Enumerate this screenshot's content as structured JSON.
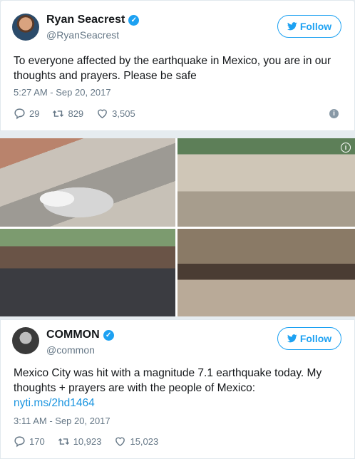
{
  "tweets": [
    {
      "display_name": "Ryan Seacrest",
      "handle": "@RyanSeacrest",
      "follow_label": "Follow",
      "text": "To everyone affected by the earthquake in Mexico, you are in our thoughts and prayers. Please be safe",
      "timestamp": "5:27 AM - Sep 20, 2017",
      "replies": "29",
      "retweets": "829",
      "likes": "3,505"
    },
    {
      "display_name": "COMMON",
      "handle": "@common",
      "follow_label": "Follow",
      "text": "Mexico City was hit with a magnitude 7.1 earthquake today. My thoughts + prayers are with the people of Mexico:",
      "link": "nyti.ms/2hd1464",
      "timestamp": "3:11 AM - Sep 20, 2017",
      "replies": "170",
      "retweets": "10,923",
      "likes": "15,023"
    }
  ],
  "icons": {
    "verified": "verified-badge-icon",
    "bird": "twitter-bird-icon",
    "reply": "reply-icon",
    "retweet": "retweet-icon",
    "like": "heart-icon",
    "info": "info-icon"
  },
  "colors": {
    "accent": "#1da1f2",
    "link": "#1b95e0",
    "muted": "#657786"
  }
}
